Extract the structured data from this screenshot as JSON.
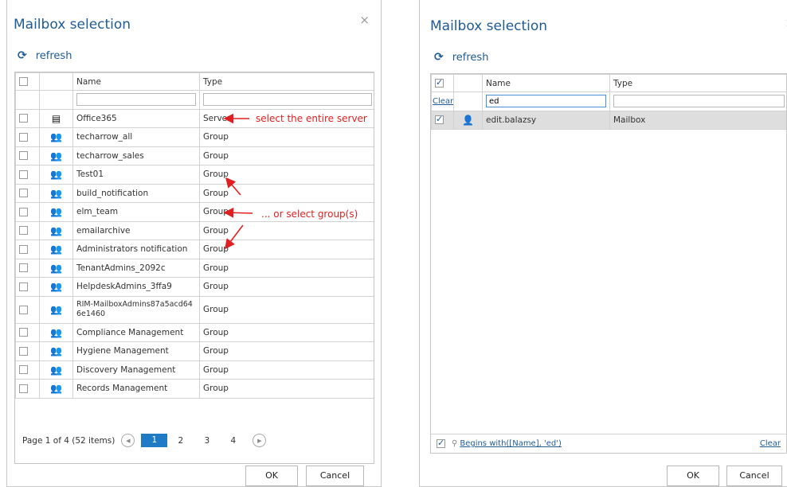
{
  "left": {
    "title": "Mailbox selection",
    "close": "×",
    "refresh": "refresh",
    "headers": {
      "name": "Name",
      "type": "Type"
    },
    "rows": [
      {
        "name": "Office365",
        "type": "Server",
        "icon": "server-icon"
      },
      {
        "name": "techarrow_all",
        "type": "Group",
        "icon": "group-icon"
      },
      {
        "name": "techarrow_sales",
        "type": "Group",
        "icon": "group-icon"
      },
      {
        "name": "Test01",
        "type": "Group",
        "icon": "group-icon"
      },
      {
        "name": "build_notification",
        "type": "Group",
        "icon": "group-icon"
      },
      {
        "name": "elm_team",
        "type": "Group",
        "icon": "group-icon"
      },
      {
        "name": "emailarchive",
        "type": "Group",
        "icon": "group-icon"
      },
      {
        "name": "Administrators notification",
        "type": "Group",
        "icon": "group-icon"
      },
      {
        "name": "TenantAdmins_2092c",
        "type": "Group",
        "icon": "group-icon"
      },
      {
        "name": "HelpdeskAdmins_3ffa9",
        "type": "Group",
        "icon": "group-icon"
      },
      {
        "name": "RIM-MailboxAdmins87a5acd646e1460",
        "type": "Group",
        "icon": "group-icon"
      },
      {
        "name": "Compliance Management",
        "type": "Group",
        "icon": "group-icon"
      },
      {
        "name": "Hygiene Management",
        "type": "Group",
        "icon": "group-icon"
      },
      {
        "name": "Discovery Management",
        "type": "Group",
        "icon": "group-icon"
      },
      {
        "name": "Records Management",
        "type": "Group",
        "icon": "group-icon"
      }
    ],
    "pager": {
      "summary": "Page 1 of 4 (52 items)",
      "pages": [
        "1",
        "2",
        "3",
        "4"
      ],
      "current": "1"
    },
    "ok": "OK",
    "cancel": "Cancel",
    "annotations": {
      "server": "select the entire server",
      "groups": "... or select group(s)"
    }
  },
  "right": {
    "title": "Mailbox selection",
    "close": "×",
    "refresh": "refresh",
    "headers": {
      "name": "Name",
      "type": "Type"
    },
    "filter_clear": "Clear",
    "filter_value": "ed",
    "rows": [
      {
        "name": "edit.balazsy",
        "type": "Mailbox",
        "icon": "user-icon",
        "checked": true
      }
    ],
    "footer_filter": "Begins with([Name], 'ed')",
    "footer_clear": "Clear",
    "ok": "OK",
    "cancel": "Cancel"
  },
  "colors": {
    "accent": "#1f5b95",
    "annotation": "#e02020",
    "page_active": "#1f7bc6"
  }
}
